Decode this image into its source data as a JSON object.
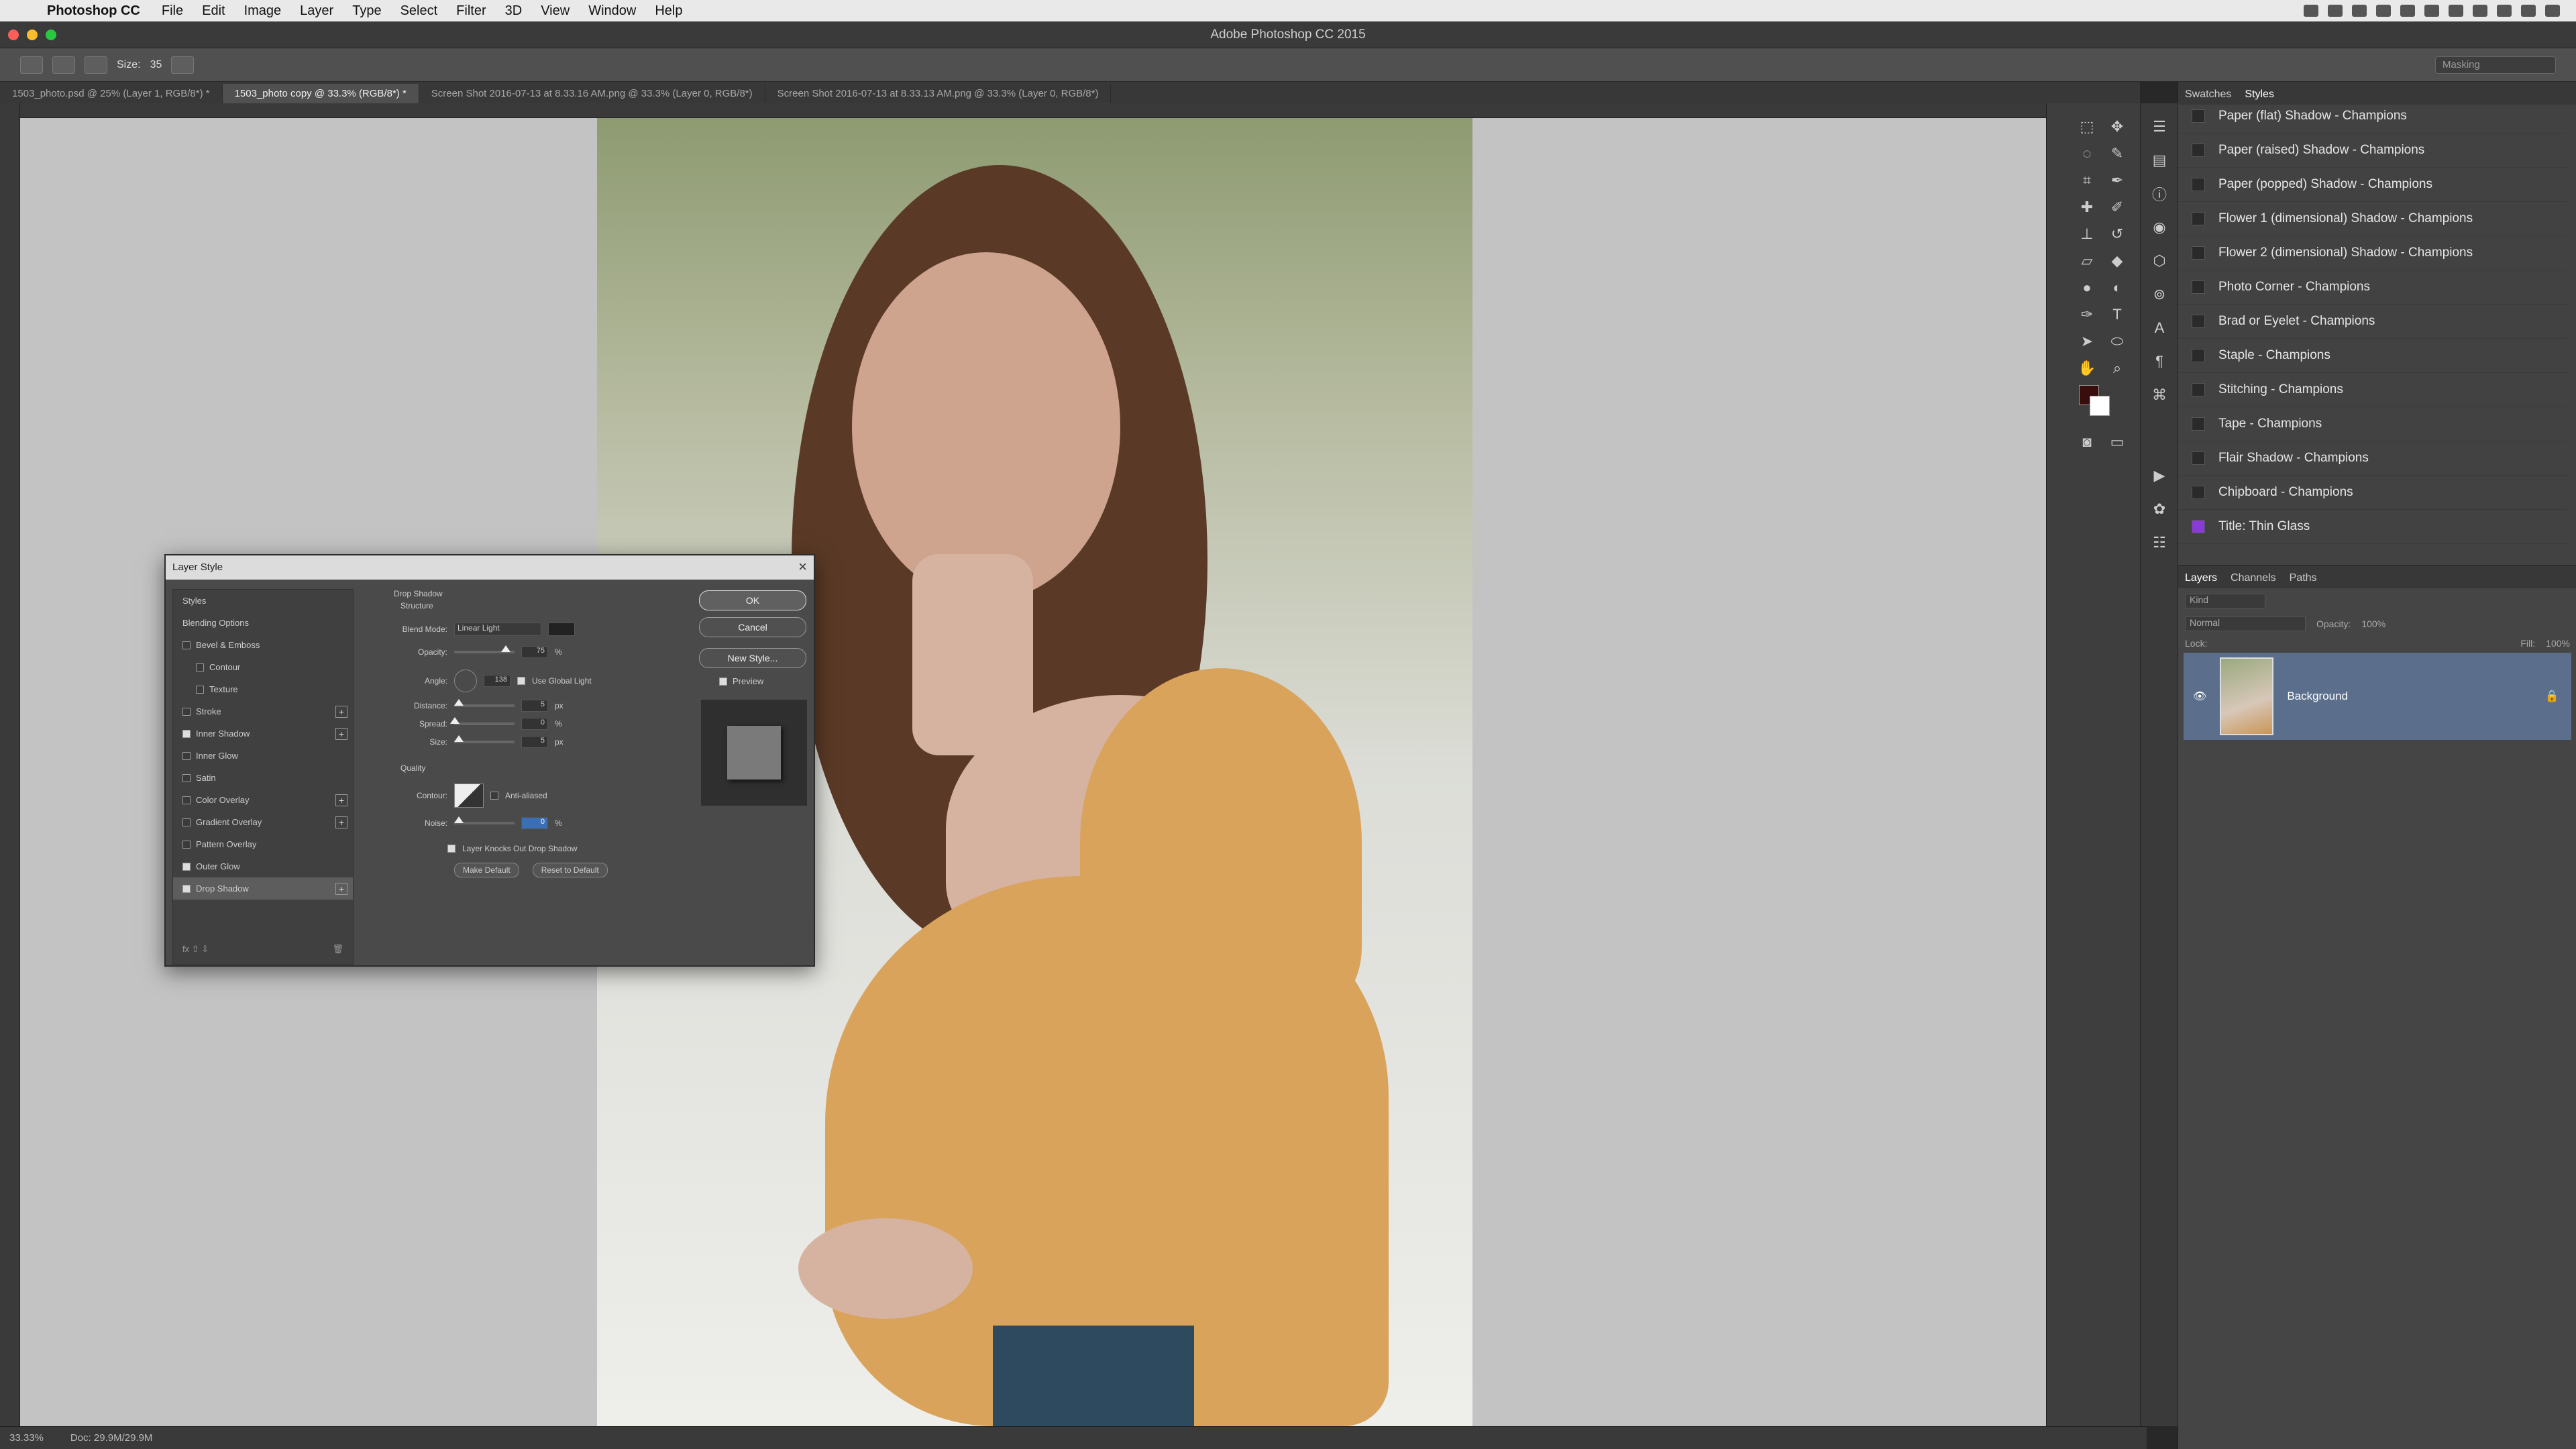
{
  "menubar": {
    "app_name": "Photoshop CC",
    "items": [
      "File",
      "Edit",
      "Image",
      "Layer",
      "Type",
      "Select",
      "Filter",
      "3D",
      "View",
      "Window",
      "Help"
    ]
  },
  "window_title": "Adobe Photoshop CC 2015",
  "options_bar": {
    "size_label": "Size:",
    "size_value": "35",
    "search_placeholder": "Masking"
  },
  "tabs": [
    "1503_photo.psd @ 25% (Layer 1, RGB/8*) *",
    "1503_photo copy @ 33.3% (RGB/8*) *",
    "Screen Shot 2016-07-13 at 8.33.16 AM.png @ 33.3% (Layer 0, RGB/8*)",
    "Screen Shot 2016-07-13 at 8.33.13 AM.png @ 33.3% (Layer 0, RGB/8*)"
  ],
  "status": {
    "zoom": "33.33%",
    "doc": "Doc: 29.9M/29.9M"
  },
  "styles_panel": {
    "tabs": [
      "Swatches",
      "Styles"
    ],
    "items": [
      "Paper (flat) Shadow - Champions",
      "Paper (raised) Shadow - Champions",
      "Paper (popped) Shadow - Champions",
      "Flower 1 (dimensional) Shadow - Champions",
      "Flower 2 (dimensional) Shadow - Champions",
      "Photo Corner - Champions",
      "Brad or Eyelet - Champions",
      "Staple - Champions",
      "Stitching - Champions",
      "Tape - Champions",
      "Flair Shadow - Champions",
      "Chipboard - Champions",
      "Title: Thin Glass"
    ]
  },
  "layers_panel": {
    "tabs": [
      "Layers",
      "Channels",
      "Paths"
    ],
    "kind": "Kind",
    "blend_mode": "Normal",
    "opacity_label": "Opacity:",
    "opacity_value": "100%",
    "lock_label": "Lock:",
    "fill_label": "Fill:",
    "fill_value": "100%",
    "layer_name": "Background"
  },
  "dialog": {
    "title": "Layer Style",
    "list": [
      {
        "label": "Styles",
        "checkbox": false,
        "checked": false,
        "plus": false
      },
      {
        "label": "Blending Options",
        "checkbox": false,
        "checked": false,
        "plus": false
      },
      {
        "label": "Bevel & Emboss",
        "checkbox": true,
        "checked": false,
        "plus": false
      },
      {
        "label": "Contour",
        "checkbox": true,
        "checked": false,
        "plus": false
      },
      {
        "label": "Texture",
        "checkbox": true,
        "checked": false,
        "plus": false
      },
      {
        "label": "Stroke",
        "checkbox": true,
        "checked": false,
        "plus": true
      },
      {
        "label": "Inner Shadow",
        "checkbox": true,
        "checked": true,
        "plus": true
      },
      {
        "label": "Inner Glow",
        "checkbox": true,
        "checked": false,
        "plus": false
      },
      {
        "label": "Satin",
        "checkbox": true,
        "checked": false,
        "plus": false
      },
      {
        "label": "Color Overlay",
        "checkbox": true,
        "checked": false,
        "plus": true
      },
      {
        "label": "Gradient Overlay",
        "checkbox": true,
        "checked": false,
        "plus": true
      },
      {
        "label": "Pattern Overlay",
        "checkbox": true,
        "checked": false,
        "plus": false
      },
      {
        "label": "Outer Glow",
        "checkbox": true,
        "checked": true,
        "plus": false
      },
      {
        "label": "Drop Shadow",
        "checkbox": true,
        "checked": true,
        "plus": true
      }
    ],
    "section_title": "Drop Shadow",
    "structure_label": "Structure",
    "blend_mode_label": "Blend Mode:",
    "blend_mode_value": "Linear Light",
    "opacity_label": "Opacity:",
    "opacity_value": "75",
    "angle_label": "Angle:",
    "angle_value": "138",
    "global_light_label": "Use Global Light",
    "distance_label": "Distance:",
    "distance_value": "5",
    "spread_label": "Spread:",
    "spread_value": "0",
    "size_label": "Size:",
    "size_value": "5",
    "px": "px",
    "percent": "%",
    "quality_label": "Quality",
    "contour_label": "Contour:",
    "anti_aliased_label": "Anti-aliased",
    "noise_label": "Noise:",
    "noise_value": "0",
    "knockout_label": "Layer Knocks Out Drop Shadow",
    "make_default": "Make Default",
    "reset_default": "Reset to Default",
    "ok": "OK",
    "cancel": "Cancel",
    "new_style": "New Style...",
    "preview": "Preview"
  }
}
